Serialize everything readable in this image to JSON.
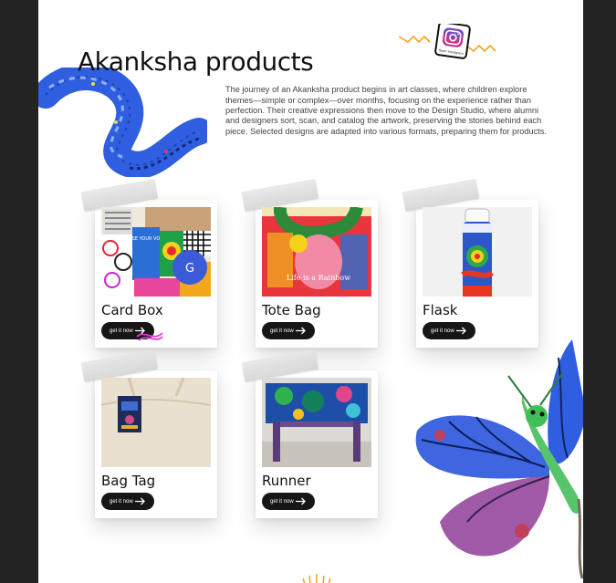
{
  "page": {
    "title": "Akanksha products",
    "description": "The journey of an Akanksha product begins in art classes, where children explore themes—simple or complex—over months, focusing on the experience rather than perfection. Their creative expressions then move to the Design Studio, where alumni and designers sort, scan, and catalog the artwork, preserving the stories behind each piece. Selected designs are adapted into various formats, preparing them for products.",
    "instagram_caption": "Open Instagram"
  },
  "products": [
    {
      "name": "Card Box",
      "button": "get it now"
    },
    {
      "name": "Tote Bag",
      "button": "get it now"
    },
    {
      "name": "Flask",
      "button": "get it now"
    },
    {
      "name": "Bag Tag",
      "button": "get it now"
    },
    {
      "name": "Runner",
      "button": "get it now"
    }
  ],
  "badge_letter": "G",
  "tote_print_text": "Life is a Rainbow",
  "card_box_print_text": "RAISE YOUR VOICE",
  "colors": {
    "background": "#232323",
    "page": "#ffffff",
    "button": "#161616",
    "accent_blue": "#2f5fe0",
    "accent_orange": "#f5a21b"
  }
}
